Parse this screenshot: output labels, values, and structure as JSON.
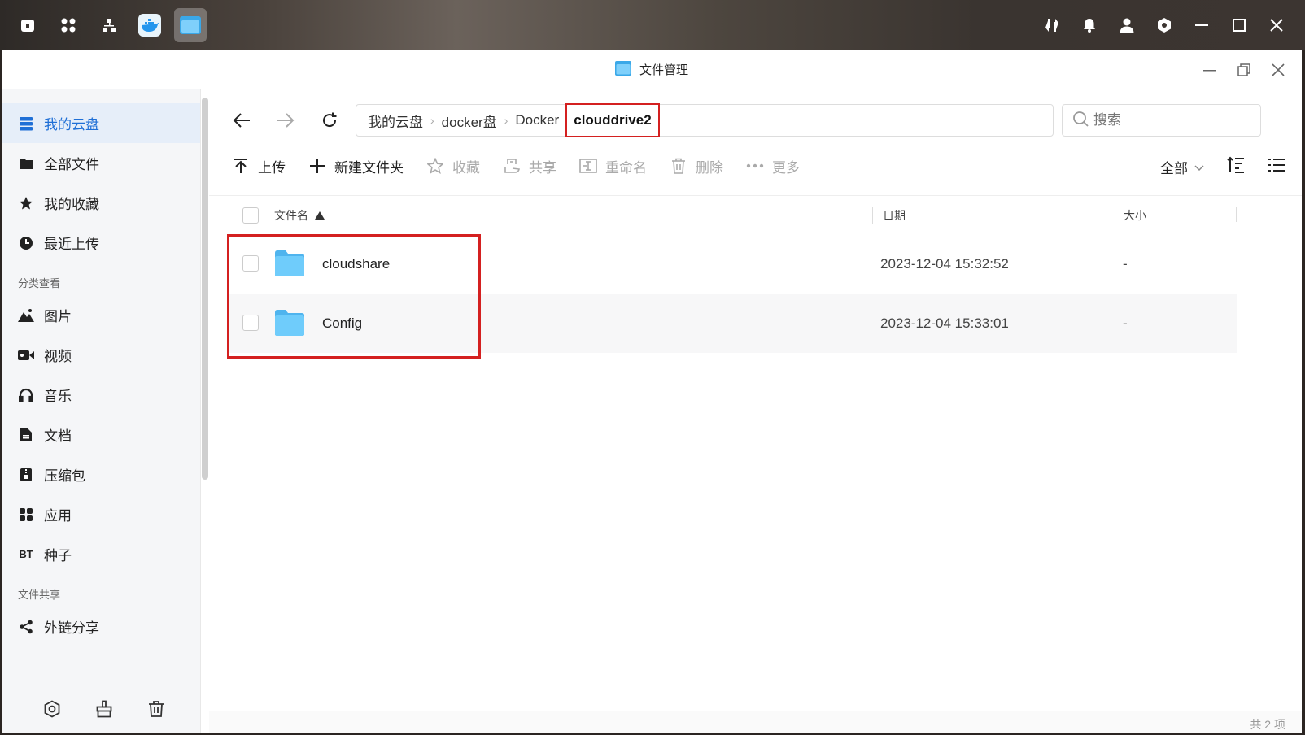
{
  "taskbar": {
    "left_icons": [
      "home-icon",
      "apps-icon",
      "network-icon",
      "docker-icon",
      "file-manager-icon"
    ],
    "right_icons": [
      "transfer-icon",
      "bell-icon",
      "user-icon",
      "settings-icon",
      "minimize-icon",
      "maximize-icon",
      "close-icon"
    ]
  },
  "window": {
    "title": "文件管理"
  },
  "sidebar": {
    "items_main": [
      {
        "label": "我的云盘",
        "icon": "storage-icon"
      },
      {
        "label": "全部文件",
        "icon": "folder-icon"
      },
      {
        "label": "我的收藏",
        "icon": "star-icon"
      },
      {
        "label": "最近上传",
        "icon": "clock-icon"
      }
    ],
    "group_category": "分类查看",
    "items_category": [
      {
        "label": "图片",
        "icon": "image-icon"
      },
      {
        "label": "视频",
        "icon": "video-icon"
      },
      {
        "label": "音乐",
        "icon": "headphones-icon"
      },
      {
        "label": "文档",
        "icon": "document-icon"
      },
      {
        "label": "压缩包",
        "icon": "archive-icon"
      },
      {
        "label": "应用",
        "icon": "apps-icon"
      },
      {
        "label": "种子",
        "icon": "bt-icon",
        "icon_text": "BT"
      }
    ],
    "group_share": "文件共享",
    "items_share": [
      {
        "label": "外链分享",
        "icon": "share-icon"
      }
    ]
  },
  "breadcrumb": [
    "我的云盘",
    "docker盘",
    "Docker",
    "clouddrive2"
  ],
  "search": {
    "placeholder": "搜索"
  },
  "toolbar": {
    "upload": "上传",
    "new_folder": "新建文件夹",
    "favorite": "收藏",
    "share": "共享",
    "rename": "重命名",
    "delete": "删除",
    "more": "更多",
    "filter": "全部"
  },
  "columns": {
    "name": "文件名",
    "date": "日期",
    "size": "大小"
  },
  "files": [
    {
      "name": "cloudshare",
      "date": "2023-12-04 15:32:52",
      "size": "-"
    },
    {
      "name": "Config",
      "date": "2023-12-04 15:33:01",
      "size": "-"
    }
  ],
  "footer": {
    "count": "共 2 项"
  },
  "colors": {
    "accent": "#1f6fd6",
    "highlight": "#d42020",
    "folder": "#5cc0f5"
  }
}
